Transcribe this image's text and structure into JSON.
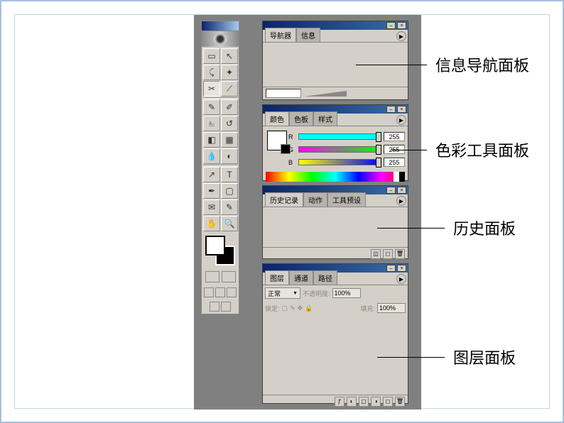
{
  "panels": {
    "nav": {
      "tabs": [
        "导航器",
        "信息"
      ]
    },
    "color": {
      "tabs": [
        "颜色",
        "色板",
        "样式"
      ],
      "sliders": [
        {
          "label": "R",
          "value": "255"
        },
        {
          "label": "G",
          "value": "255"
        },
        {
          "label": "B",
          "value": "255"
        }
      ]
    },
    "history": {
      "tabs": [
        "历史记录",
        "动作",
        "工具预设"
      ]
    },
    "layer": {
      "tabs": [
        "图层",
        "通道",
        "路径"
      ],
      "mode_label": "正常",
      "opacity_label": "不透明度:",
      "opacity_value": "100%",
      "lock_label": "锁定:",
      "fill_label": "填充:",
      "fill_value": "100%"
    }
  },
  "annotations": {
    "nav": "信息导航面板",
    "color": "色彩工具面板",
    "history": "历史面板",
    "layer": "图层面板"
  },
  "icons": {
    "minimize": "–",
    "close": "×",
    "menu": "▶"
  }
}
